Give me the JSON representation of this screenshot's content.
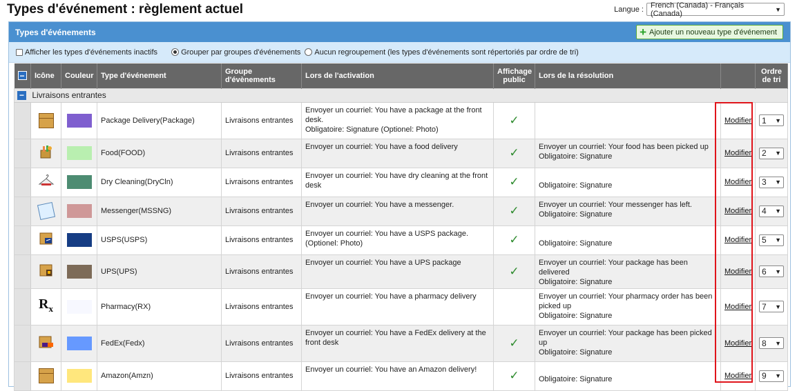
{
  "page_title": "Types d'événement : règlement actuel",
  "language": {
    "label": "Langue :",
    "value": "French (Canada) - Français (Canada)"
  },
  "panel": {
    "title": "Types d'événements",
    "add_button": "Ajouter un nouveau type d'événement"
  },
  "options": {
    "show_inactive": "Afficher les types d'événements inactifs",
    "group_by": "Grouper par groupes d'événements",
    "no_group": "Aucun regroupement (les types d'événements sont répertoriés par ordre de tri)"
  },
  "columns": {
    "icon": "Icône",
    "color": "Couleur",
    "type": "Type d'événement",
    "group_line1": "Groupe",
    "group_line2": "d'évènements",
    "activation": "Lors de l'activation",
    "public_line1": "Affichage",
    "public_line2": "public",
    "resolution": "Lors de la résolution",
    "sort_line1": "Ordre",
    "sort_line2": "de tri"
  },
  "group": {
    "label": "Livraisons entrantes"
  },
  "check_glyph": "✓",
  "rows": [
    {
      "icon": "package-icon",
      "color": "#7f5fcf",
      "type": "Package Delivery(Package)",
      "group": "Livraisons entrantes",
      "activation": [
        "Envoyer un courriel: You have a package at the front",
        "desk.",
        "Obligatoire: Signature (Optionel: Photo)"
      ],
      "public": "✓",
      "resolution": [],
      "modify": "Modifier",
      "sort": "1"
    },
    {
      "icon": "food-icon",
      "color": "#b9efb0",
      "type": "Food(FOOD)",
      "group": "Livraisons entrantes",
      "activation": [
        "Envoyer un courriel: You have a food delivery"
      ],
      "public": "✓",
      "resolution": [
        "Envoyer un courriel: Your food has been picked up",
        "Obligatoire: Signature"
      ],
      "modify": "Modifier",
      "sort": "2"
    },
    {
      "icon": "dry-cleaning-icon",
      "color": "#4d8c72",
      "type": "Dry Cleaning(DryCln)",
      "group": "Livraisons entrantes",
      "activation": [
        "Envoyer un courriel: You have dry cleaning at the front",
        "desk"
      ],
      "public": "✓",
      "resolution": [
        "",
        "Obligatoire: Signature"
      ],
      "modify": "Modifier",
      "sort": "3"
    },
    {
      "icon": "messenger-icon",
      "color": "#cf9898",
      "type": "Messenger(MSSNG)",
      "group": "Livraisons entrantes",
      "activation": [
        "Envoyer un courriel: You have a messenger."
      ],
      "public": "✓",
      "resolution": [
        "Envoyer un courriel: Your messenger has left.",
        "Obligatoire: Signature"
      ],
      "modify": "Modifier",
      "sort": "4"
    },
    {
      "icon": "usps-icon",
      "color": "#163d84",
      "type": "USPS(USPS)",
      "group": "Livraisons entrantes",
      "activation": [
        "Envoyer un courriel: You have a USPS package.",
        "(Optionel: Photo)"
      ],
      "public": "✓",
      "resolution": [
        "",
        "Obligatoire: Signature"
      ],
      "modify": "Modifier",
      "sort": "5"
    },
    {
      "icon": "ups-icon",
      "color": "#7d6b58",
      "type": "UPS(UPS)",
      "group": "Livraisons entrantes",
      "activation": [
        "Envoyer un courriel: You have a UPS package"
      ],
      "public": "✓",
      "resolution": [
        "Envoyer un courriel: Your package has been delivered",
        "Obligatoire: Signature"
      ],
      "modify": "Modifier",
      "sort": "6"
    },
    {
      "icon": "pharmacy-icon",
      "color": "#f7f8ff",
      "type": "Pharmacy(RX)",
      "group": "Livraisons entrantes",
      "activation": [
        "Envoyer un courriel: You have a pharmacy delivery"
      ],
      "public": "",
      "resolution": [
        "Envoyer un courriel: Your pharmacy order has been",
        "picked up",
        "Obligatoire: Signature"
      ],
      "modify": "Modifier",
      "sort": "7"
    },
    {
      "icon": "fedex-icon",
      "color": "#6699ff",
      "type": "FedEx(Fedx)",
      "group": "Livraisons entrantes",
      "activation": [
        "Envoyer un courriel: You have a FedEx delivery at the",
        "front desk"
      ],
      "public": "✓",
      "resolution": [
        "Envoyer un courriel: Your package has been picked",
        "up",
        "Obligatoire: Signature"
      ],
      "modify": "Modifier",
      "sort": "8"
    },
    {
      "icon": "amazon-icon",
      "color": "#ffe77d",
      "type": "Amazon(Amzn)",
      "group": "Livraisons entrantes",
      "activation": [
        "Envoyer un courriel: You have an Amazon delivery!"
      ],
      "public": "✓",
      "resolution": [
        "",
        "Obligatoire: Signature"
      ],
      "modify": "Modifier",
      "sort": "9"
    }
  ]
}
